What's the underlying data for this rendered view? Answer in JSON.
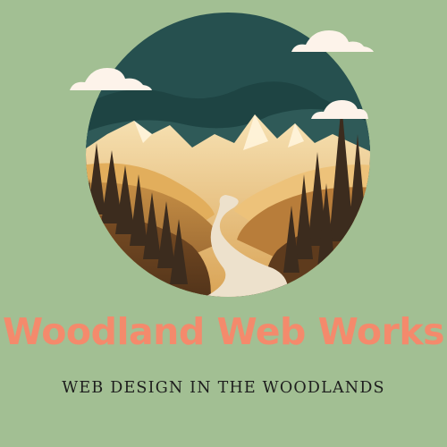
{
  "brand": {
    "name": "Woodland Web Works",
    "tagline": "WEB DESIGN IN THE WOODLANDS"
  },
  "colors": {
    "background": "#a2bf93",
    "brand_text": "#f48a6c",
    "tagline_text": "#1d1d1d",
    "sky": "#26504f",
    "cloud": "#fdf3ea"
  },
  "logo": {
    "icon": "mountain-valley-river-landscape-icon"
  }
}
